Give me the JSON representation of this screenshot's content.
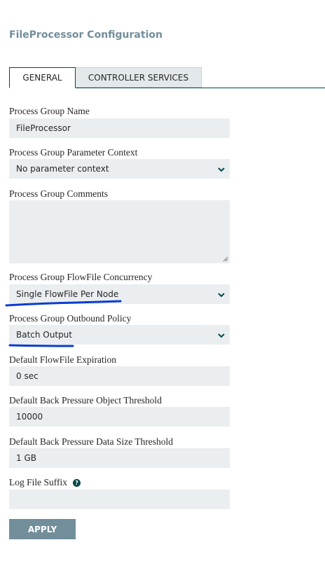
{
  "header": {
    "title": "FileProcessor Configuration"
  },
  "tabs": [
    {
      "label": "GENERAL",
      "active": true
    },
    {
      "label": "CONTROLLER SERVICES",
      "active": false
    }
  ],
  "fields": {
    "group_name": {
      "label": "Process Group Name",
      "value": "FileProcessor"
    },
    "parameter_context": {
      "label": "Process Group Parameter Context",
      "value": "No parameter context"
    },
    "comments": {
      "label": "Process Group Comments",
      "value": ""
    },
    "flowfile_concurrency": {
      "label": "Process Group FlowFile Concurrency",
      "value": "Single FlowFile Per Node"
    },
    "outbound_policy": {
      "label": "Process Group Outbound Policy",
      "value": "Batch Output"
    },
    "flowfile_expiration": {
      "label": "Default FlowFile Expiration",
      "value": "0 sec"
    },
    "bp_object_threshold": {
      "label": "Default Back Pressure Object Threshold",
      "value": "10000"
    },
    "bp_size_threshold": {
      "label": "Default Back Pressure Data Size Threshold",
      "value": "1 GB"
    },
    "log_file_suffix": {
      "label": "Log File Suffix",
      "value": ""
    }
  },
  "icons": {
    "dropdown": "chevron-down-icon",
    "help": "question-circle-icon",
    "resize": "resize-handle-icon"
  },
  "colors": {
    "title": "#728e9b",
    "tab_border": "#004849",
    "field_bg": "#eaeef0",
    "button_bg": "#728e9b",
    "annotation": "#0a3ccf"
  },
  "footer": {
    "apply_label": "APPLY"
  }
}
